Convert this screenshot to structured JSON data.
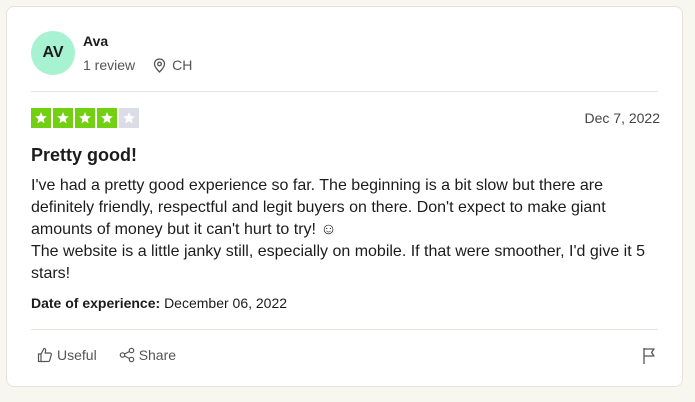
{
  "reviewer": {
    "initials": "AV",
    "name": "Ava",
    "review_count": "1 review",
    "location": "CH",
    "avatar_color": "#a6f2d1"
  },
  "review": {
    "rating": 4,
    "max_rating": 5,
    "star_color": "#73cf11",
    "date": "Dec 7, 2022",
    "title": "Pretty good!",
    "body_line1": "I've had a pretty good experience so far. The beginning is a bit slow but there are definitely friendly, respectful and legit buyers on there. Don't expect to make giant amounts of money but it can't hurt to try! ☺",
    "body_line2": "The website is a little janky still, especially on mobile. If that were smoother, I'd give it 5 stars!",
    "experience_label": "Date of experience:",
    "experience_date": "December 06, 2022"
  },
  "actions": {
    "useful_label": "Useful",
    "share_label": "Share",
    "icons": [
      "thumbs-up-icon",
      "share-icon",
      "flag-icon",
      "location-pin-icon"
    ]
  }
}
